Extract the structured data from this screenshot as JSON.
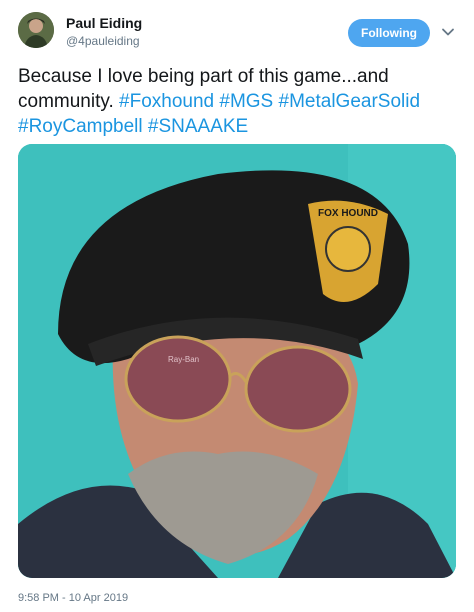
{
  "author": {
    "display_name": "Paul Eiding",
    "handle": "@4pauleiding",
    "follow_label": "Following"
  },
  "tweet": {
    "text_plain": "Because I love being part of this game...and community. ",
    "hashtags": [
      "#Foxhound",
      "#MGS",
      "#MetalGearSolid",
      "#RoyCampbell",
      "#SNAAAKE"
    ],
    "timestamp": "9:58 PM - 10 Apr 2019"
  },
  "photo": {
    "patch_text": "FOX HOUND",
    "glasses_brand": "Ray-Ban"
  },
  "colors": {
    "accent": "#1b95e0",
    "follow_button": "#4ea6f0",
    "photo_background": "#3ec0bd",
    "beret": "#1a1a1a"
  }
}
